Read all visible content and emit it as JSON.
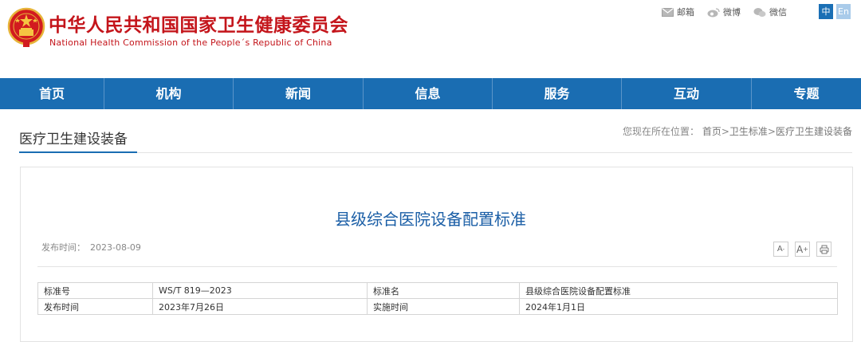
{
  "header": {
    "title_cn": "中华人民共和国国家卫生健康委员会",
    "title_en": "National Health Commission of the People´s Republic of China",
    "links": [
      {
        "label": "邮箱",
        "icon": "mail-icon"
      },
      {
        "label": "微博",
        "icon": "weibo-icon"
      },
      {
        "label": "微信",
        "icon": "wechat-icon"
      }
    ],
    "lang_zh": "中",
    "lang_en": "En"
  },
  "nav": {
    "items": [
      "首页",
      "机构",
      "新闻",
      "信息",
      "服务",
      "互动",
      "专题"
    ]
  },
  "section": {
    "title": "医疗卫生建设装备",
    "breadcrumb_prefix": "您现在所在位置：",
    "crumbs": [
      "首页",
      "卫生标准",
      "医疗卫生建设装备"
    ],
    "separator": ">"
  },
  "article": {
    "title": "县级综合医院设备配置标准",
    "pubdate_label": "发布时间：",
    "pubdate_value": "2023-08-09",
    "tools": {
      "font_small": "A",
      "font_large": "A",
      "font_large_sup": "+",
      "font_small_sup": "-"
    }
  },
  "table": {
    "rows": [
      [
        "标准号",
        "WS/T 819—2023",
        "标准名",
        "县级综合医院设备配置标准"
      ],
      [
        "发布时间",
        "2023年7月26日",
        "实施时间",
        "2024年1月1日"
      ]
    ]
  },
  "colors": {
    "brand_red": "#c4151b",
    "nav_blue": "#1a6db2",
    "title_blue": "#1a5ea6"
  }
}
